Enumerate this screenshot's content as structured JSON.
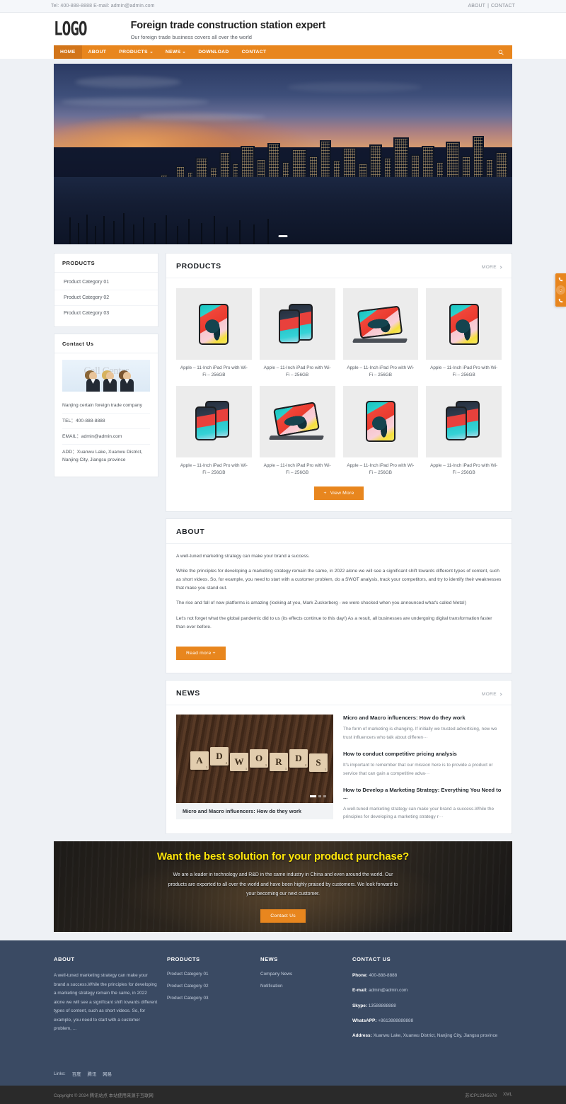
{
  "topbar": {
    "contact": "Tel: 400-888-8888 E-mail: admin@admin.com",
    "about_link": "ABOUT",
    "separator": "|",
    "contact_link": "CONTACT"
  },
  "header": {
    "logo": "LOGO",
    "title": "Foreign trade construction station expert",
    "subtitle": "Our foreign trade business covers all over the world"
  },
  "nav": {
    "items": [
      {
        "label": "HOME",
        "has_caret": false,
        "active": true
      },
      {
        "label": "ABOUT",
        "has_caret": false,
        "active": false
      },
      {
        "label": "PRODUCTS",
        "has_caret": true,
        "active": false
      },
      {
        "label": "NEWS",
        "has_caret": true,
        "active": false
      },
      {
        "label": "DOWNLOAD",
        "has_caret": false,
        "active": false
      },
      {
        "label": "CONTACT",
        "has_caret": false,
        "active": false
      }
    ],
    "search_icon": "search-icon"
  },
  "hero": {
    "alt": "city skyline at dusk banner",
    "slides": 1
  },
  "sidebar": {
    "products": {
      "heading": "PRODUCTS",
      "items": [
        "Product Category 01",
        "Product Category 02",
        "Product Category 03"
      ]
    },
    "contact": {
      "heading": "Contact Us",
      "image_caption": "Call Center",
      "lines": [
        "Nanjing certain foreign trade company",
        "TEL：400-888-8888",
        "EMAIL：admin@admin.com",
        "ADD：Xuanwu Lake, Xuanwu District, Nanjing City, Jiangsu province"
      ]
    }
  },
  "products_section": {
    "title": "PRODUCTS",
    "more": "MORE",
    "view_more": "View More",
    "items": [
      {
        "name": "Apple – 11-Inch iPad Pro with Wi-Fi – 256GB",
        "art": "tablet-front-a"
      },
      {
        "name": "Apple – 11-Inch iPad Pro with Wi-Fi – 256GB",
        "art": "tablet-pair-b"
      },
      {
        "name": "Apple – 11-Inch iPad Pro with Wi-Fi – 256GB",
        "art": "tablet-stand-a"
      },
      {
        "name": "Apple – 11-Inch iPad Pro with Wi-Fi – 256GB",
        "art": "tablet-front-a"
      },
      {
        "name": "Apple – 11-Inch iPad Pro with Wi-Fi – 256GB",
        "art": "tablet-pair-b"
      },
      {
        "name": "Apple – 11-Inch iPad Pro with Wi-Fi – 256GB",
        "art": "tablet-stand-a"
      },
      {
        "name": "Apple – 11-Inch iPad Pro with Wi-Fi – 256GB",
        "art": "tablet-front-a"
      },
      {
        "name": "Apple – 11-Inch iPad Pro with Wi-Fi – 256GB",
        "art": "tablet-pair-b"
      }
    ]
  },
  "about_section": {
    "title": "ABOUT",
    "paragraphs": [
      "A well-tuned marketing strategy can make your brand a success.",
      "While the principles for developing a marketing strategy remain the same, in 2022 alone we will see a significant shift towards different types of content, such as short videos. So, for example, you need to start with a customer problem, do a SWOT analysis, track your competitors, and try to identify their weaknesses that make you stand out.",
      "The rise and fall of new platforms is amazing (looking at you, Mark Zuckerberg - we were shocked when you announced what's called Meta!)",
      "Let's not forget what the global pandemic did to us (its effects continue to this day!) As a result, all businesses are undergoing digital transformation faster than ever before."
    ],
    "read_more": "Read more +"
  },
  "news_section": {
    "title": "NEWS",
    "more": "MORE",
    "featured_caption": "Micro and Macro influencers: How do they work",
    "featured_image_word": "ADWORDS",
    "items": [
      {
        "title": "Micro and Macro influencers: How do they work",
        "desc": "The form of marketing is changing. If initially we trusted advertising, now we trust influencers who talk about differen···"
      },
      {
        "title": "How to conduct competitive pricing analysis",
        "desc": "It's important to remember that our mission here is to provide a product or service that can gain a competitive adva···"
      },
      {
        "title": "How to Develop a Marketing Strategy: Everything You Need to ...",
        "desc": "A well-tuned marketing strategy can make your brand a success.While the principles for developing a marketing strategy r···"
      }
    ]
  },
  "cta": {
    "title": "Want the best solution for your product purchase?",
    "text": "We are a leader in technology and R&D in the same industry in China and even around the world. Our products are exported to all over the world and have been highly praised by customers. We look forward to your becoming our next customer.",
    "button": "Contact Us"
  },
  "footer": {
    "about": {
      "heading": "ABOUT",
      "text": "A well-tuned marketing strategy can make your brand a success.While the principles for developing a marketing strategy remain the same, in 2022 alone we will see a significant shift towards different types of content, such as short videos. So, for example, you need to start with a customer problem, ..."
    },
    "products": {
      "heading": "PRODUCTS",
      "items": [
        "Product Category 01",
        "Product Category 02",
        "Product Category 03"
      ]
    },
    "news": {
      "heading": "NEWS",
      "items": [
        "Company News",
        "Notification"
      ]
    },
    "contact": {
      "heading": "CONTACT US",
      "phone_label": "Phone:",
      "phone": "400-888-8888",
      "email_label": "E-mail:",
      "email": "admin@admin.com",
      "skype_label": "Skype:",
      "skype": "13588888888",
      "whatsapp_label": "WhatsAPP:",
      "whatsapp": "+8613888888888",
      "address_label": "Address:",
      "address": "Xuanwu Lake, Xuanwu District, Nanjing City, Jiangsu province"
    },
    "links_label": "Links:",
    "links": [
      "百度",
      "腾讯",
      "网易"
    ]
  },
  "copybar": {
    "left": "Copyright © 2024 腾讯站点 本站使用来源于互联网",
    "icp": "苏ICP12345678",
    "xml": "XML"
  },
  "float_widget": {
    "items": [
      "phone-icon",
      "qq-icon",
      "mobile-icon"
    ]
  },
  "colors": {
    "accent": "#e8861e",
    "accent_dark": "#d2751a",
    "footer_bg": "#3a4a63",
    "copybar_bg": "#2a2a2a",
    "cta_title": "#ffe60a",
    "page_bg": "#eef1f5"
  }
}
